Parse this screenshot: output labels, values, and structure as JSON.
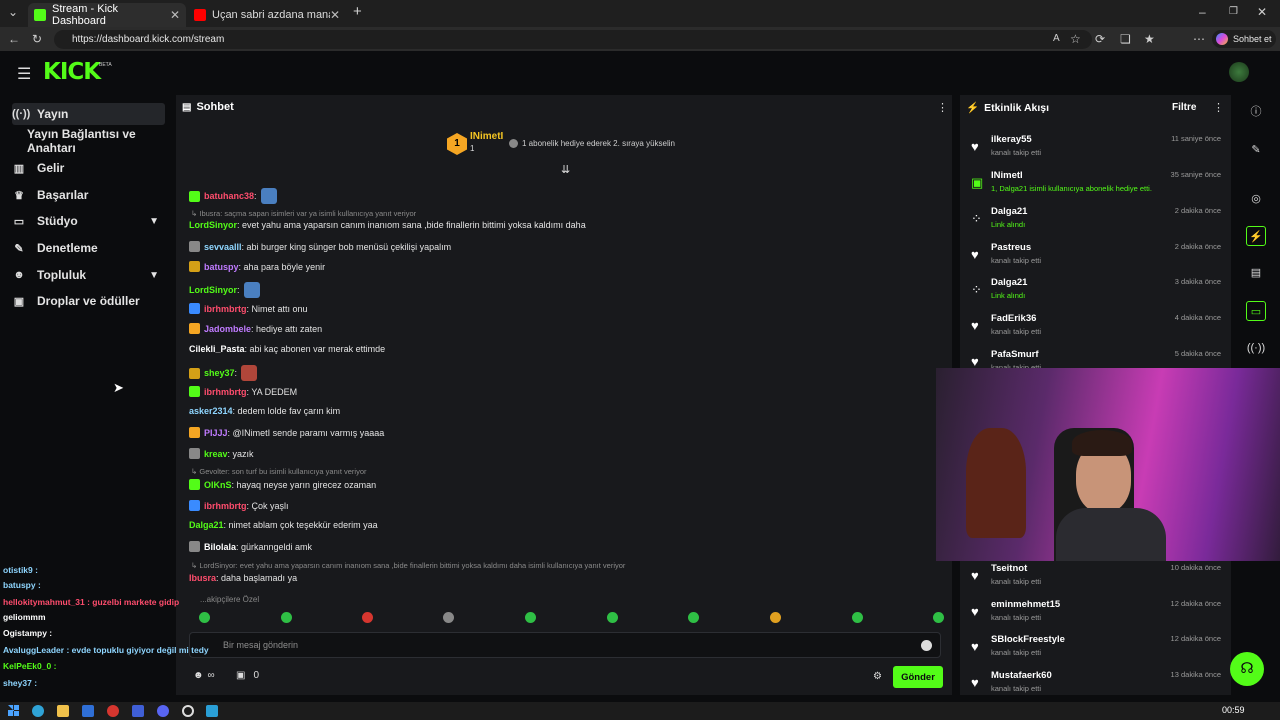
{
  "browser": {
    "tabs": [
      {
        "label": "Stream - Kick Dashboard"
      },
      {
        "label": "Uçan sabri azdana mananga - You"
      }
    ],
    "url": "https://dashboard.kick.com/stream",
    "profile_label": "Sohbet et"
  },
  "header": {
    "logo": "KICK",
    "beta": "BETA"
  },
  "sidebar": {
    "items": [
      {
        "label": "Yayın",
        "icon": "broadcast-icon"
      },
      {
        "label": "Yayın Bağlantısı ve Anahtarı",
        "icon": ""
      },
      {
        "label": "Gelir",
        "icon": "chart-icon"
      },
      {
        "label": "Başarılar",
        "icon": "trophy-icon"
      },
      {
        "label": "Stüdyo",
        "icon": "monitor-icon"
      },
      {
        "label": "Denetleme",
        "icon": "wrench-icon"
      },
      {
        "label": "Topluluk",
        "icon": "people-icon"
      },
      {
        "label": "Droplar ve ödüller",
        "icon": "gift-icon"
      }
    ]
  },
  "chat": {
    "title": "Sohbet",
    "pinned_user": "INimetI",
    "pinned_rank": "1",
    "pinned_count": "1",
    "pinned_text": "1 abonelik hediye ederek 2. sıraya yükselin",
    "messages": [
      {
        "user": "batuhanc38",
        "text": ":",
        "color": "#ff4d6d"
      },
      {
        "reply": "Ibusra: saçma sapan isimleri var ya isimli kullanıcıya yanıt veriyor"
      },
      {
        "user": "LordSinyor",
        "text": ": evet yahu ama yaparsın canım inanıom sana ,bide finallerin bittimi yoksa kaldımı daha",
        "color": "#53fc18"
      },
      {
        "user": "sevvaalll",
        "text": ": abi burger king sünger bob menüsü çekilişi yapalım",
        "color": "#8fd6ff"
      },
      {
        "user": "batuspy",
        "text": ": aha para böyle yenir",
        "color": "#c07bff"
      },
      {
        "user": "LordSinyor",
        "text": ":",
        "color": "#53fc18"
      },
      {
        "user": "ibrhmbrtg",
        "text": ": Nimet attı onu",
        "color": "#ff4d6d"
      },
      {
        "user": "Jadombele",
        "text": ": hediye attı zaten",
        "color": "#c07bff"
      },
      {
        "user": "Cilekli_Pasta",
        "text": ": abi kaç abonen var merak ettimde",
        "color": "#ffffff"
      },
      {
        "user": "shey37",
        "text": ":",
        "color": "#53fc18"
      },
      {
        "user": "ibrhmbrtg",
        "text": ": YA DEDEM",
        "color": "#ff4d6d"
      },
      {
        "user": "asker2314",
        "text": ": dedem lolde fav çarın kim",
        "color": "#8fd6ff"
      },
      {
        "user": "PIJJJ",
        "text": ": @INimetI sende paramı varmış yaaaa",
        "color": "#c07bff"
      },
      {
        "user": "kreav",
        "text": ": yazık",
        "color": "#53fc18"
      },
      {
        "reply": "Gevolter: son turf bu isimli kullanıcıya yanıt veriyor"
      },
      {
        "user": "OIKnS",
        "text": ": hayaq neyse yarın girecez ozaman",
        "color": "#53fc18"
      },
      {
        "user": "ibrhmbrtg",
        "text": ": Çok yaşlı",
        "color": "#ff4d6d"
      },
      {
        "user": "Dalga21",
        "text": ": nimet ablam çok teşekkür ederim yaa",
        "color": "#53fc18"
      },
      {
        "user": "Bilolala",
        "text": ": gürkanngeldi amk",
        "color": "#ffffff"
      },
      {
        "reply": "LordSinyor: evet yahu ama yaparsın canım inanıom sana ,bide finallerin bittimi yoksa kaldımı daha isimli kullanıcıya yanıt veriyor"
      },
      {
        "user": "Ibusra",
        "text": ": daha başlamadı ya",
        "color": "#ff4d6d"
      }
    ],
    "subscriber_label": "...akipçilere Özel",
    "input_placeholder": "Bir mesaj gönderin",
    "viewer_count": "0",
    "send_label": "Gönder"
  },
  "activity": {
    "title": "Etkinlik Akışı",
    "filter_label": "Filtre",
    "events": [
      {
        "user": "ilkeray55",
        "detail": "kanalı takip etti",
        "time": "11 saniye önce",
        "icon": "heart-icon"
      },
      {
        "user": "INimetI",
        "detail": "1, Dalga21 isimli kullanıcıya abonelik hediye etti.",
        "time": "35 saniye önce",
        "icon": "gift-icon"
      },
      {
        "user": "Dalga21",
        "detail": "Link alındı",
        "time": "2 dakika önce",
        "icon": "drop-icon"
      },
      {
        "user": "Pastreus",
        "detail": "kanalı takip etti",
        "time": "2 dakika önce",
        "icon": "heart-icon"
      },
      {
        "user": "Dalga21",
        "detail": "Link alındı",
        "time": "3 dakika önce",
        "icon": "drop-icon"
      },
      {
        "user": "FadErik36",
        "detail": "kanalı takip etti",
        "time": "4 dakika önce",
        "icon": "heart-icon"
      },
      {
        "user": "PafaSmurf",
        "detail": "kanalı takip etti",
        "time": "5 dakika önce",
        "icon": "heart-icon"
      },
      {
        "user": "Tseitnot",
        "detail": "kanalı takip etti",
        "time": "10 dakika önce",
        "icon": "heart-icon"
      },
      {
        "user": "eminmehmet15",
        "detail": "kanalı takip etti",
        "time": "12 dakika önce",
        "icon": "heart-icon"
      },
      {
        "user": "SBlockFreestyle",
        "detail": "kanalı takip etti",
        "time": "12 dakika önce",
        "icon": "heart-icon"
      },
      {
        "user": "Mustafaerk60",
        "detail": "kanalı takip etti",
        "time": "13 dakika önce",
        "icon": "heart-icon"
      }
    ]
  },
  "overlay_chat": [
    {
      "text": "otistik9 :",
      "color": "#8fd6ff"
    },
    {
      "text": "batuspy :",
      "color": "#8fd6ff"
    },
    {
      "text": "hellokitymahmut_31 : guzelbi markete gidip",
      "color": "#ff4d6d"
    },
    {
      "text": "geliommm",
      "color": "#ffffff"
    },
    {
      "text": "Ogistampy :",
      "color": "#ffffff"
    },
    {
      "text": "AvaluggLeader : evde topuklu giyiyor değil mi tedy",
      "color": "#8fd6ff"
    },
    {
      "text": "KelPeEk0_0 :",
      "color": "#53fc18"
    },
    {
      "text": "shey37 :",
      "color": "#8fd6ff"
    }
  ],
  "taskbar": {
    "time": "00:59"
  },
  "colors": {
    "accent": "#53fc18",
    "panel": "#18191c",
    "background": "#0b0c0e"
  }
}
